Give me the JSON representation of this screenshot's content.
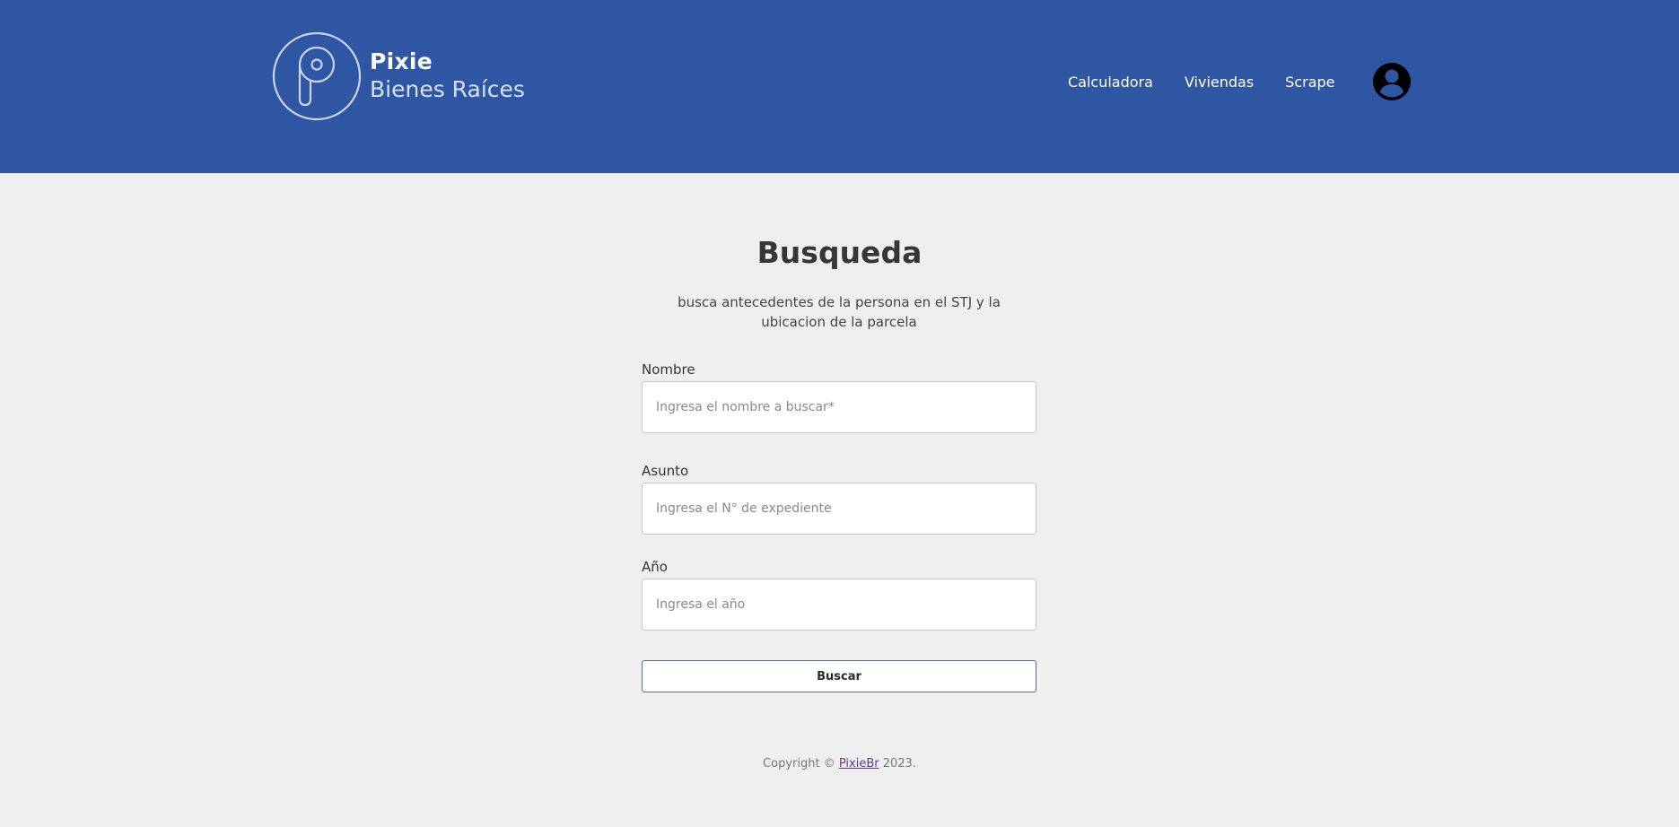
{
  "header": {
    "logo": {
      "name": "Pixie",
      "tagline": "Bienes Raíces",
      "icon": "pixie-p-logo-icon"
    },
    "nav": [
      {
        "label": "Calculadora"
      },
      {
        "label": "Viviendas"
      },
      {
        "label": "Scrape"
      }
    ],
    "avatar_icon": "user-avatar-icon"
  },
  "main": {
    "title": "Busqueda",
    "subtitle": "busca antecedentes de la persona en el STJ y la ubicacion de la parcela",
    "form": {
      "fields": [
        {
          "label": "Nombre",
          "placeholder": "Ingresa el nombre a buscar*",
          "value": ""
        },
        {
          "label": "Asunto",
          "placeholder": "Ingresa el N° de expediente",
          "value": ""
        },
        {
          "label": "Año",
          "placeholder": "Ingresa el año",
          "value": ""
        }
      ],
      "submit_label": "Buscar"
    }
  },
  "footer": {
    "prefix": "Copyright © ",
    "link": "PixieBr",
    "suffix": " 2023."
  },
  "colors": {
    "header_bg": "#2e56a3",
    "page_bg": "#efefef",
    "button_border": "#4a6fb2",
    "footer_link": "#5c3a8f"
  }
}
